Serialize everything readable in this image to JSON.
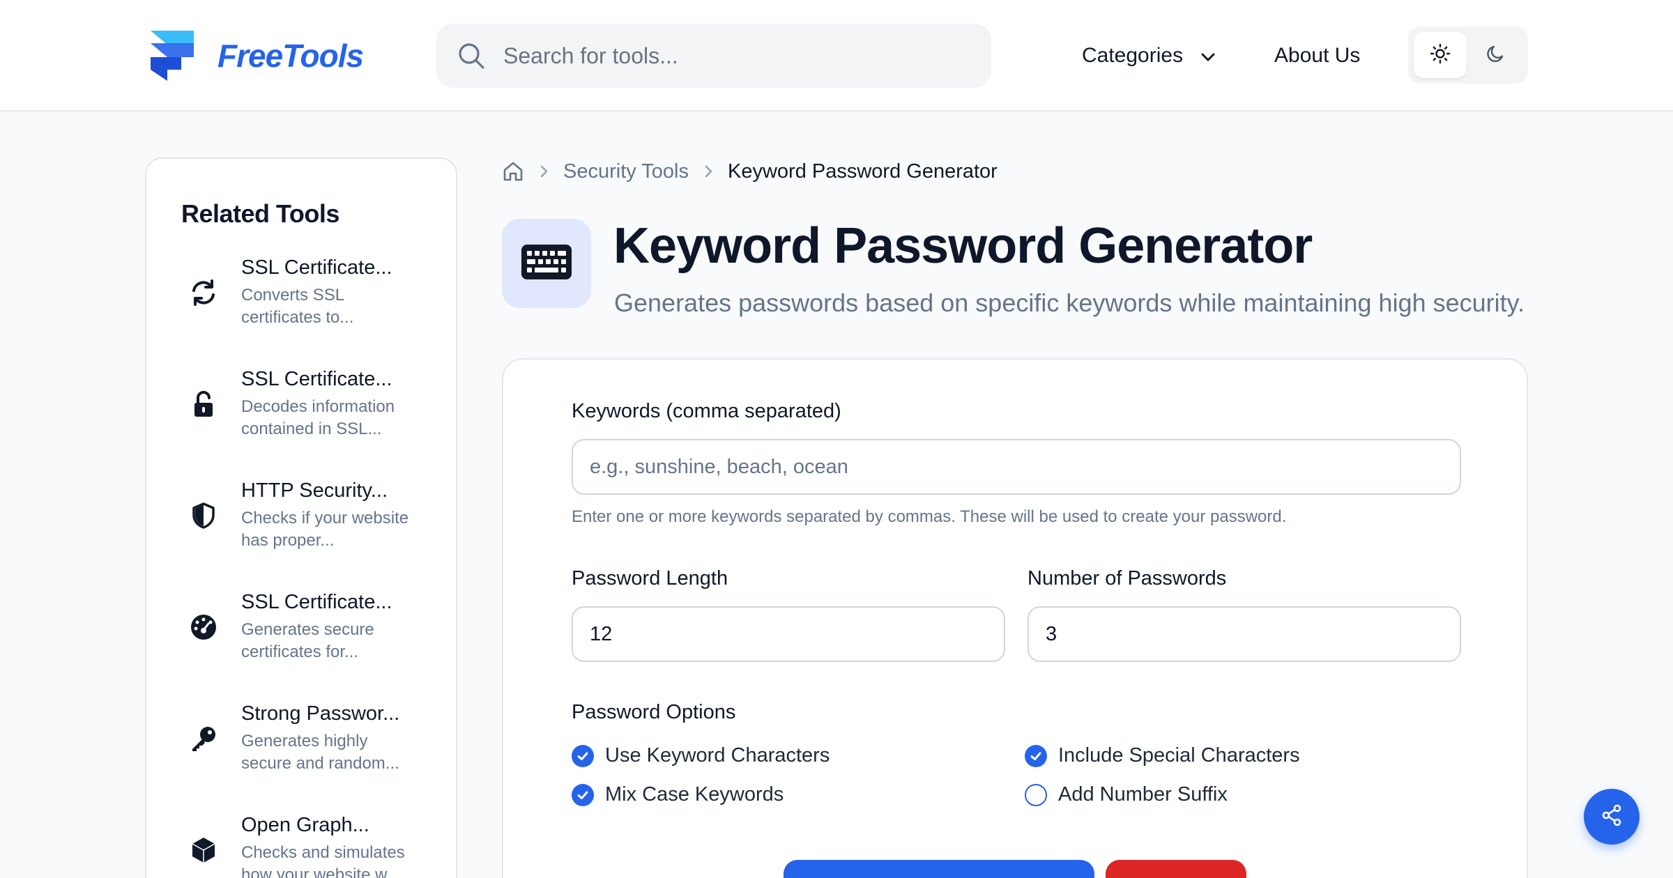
{
  "header": {
    "brand": "FreeTools",
    "search_placeholder": "Search for tools...",
    "nav": {
      "categories": "Categories",
      "about": "About Us"
    },
    "theme": {
      "selected": "light"
    }
  },
  "sidebar": {
    "title": "Related Tools",
    "items": [
      {
        "name": "SSL Certificate...",
        "desc": "Converts SSL certificates to...",
        "icon": "refresh-icon"
      },
      {
        "name": "SSL Certificate...",
        "desc": "Decodes information contained in SSL...",
        "icon": "unlock-icon"
      },
      {
        "name": "HTTP Security...",
        "desc": "Checks if your website has proper...",
        "icon": "shield-icon"
      },
      {
        "name": "SSL Certificate...",
        "desc": "Generates secure certificates for...",
        "icon": "gauge-icon"
      },
      {
        "name": "Strong Passwor...",
        "desc": "Generates highly secure and random...",
        "icon": "key-icon"
      },
      {
        "name": "Open Graph...",
        "desc": "Checks and simulates how your website w...",
        "icon": "cube-icon"
      }
    ]
  },
  "breadcrumb": {
    "section": "Security Tools",
    "current": "Keyword Password Generator"
  },
  "page": {
    "title": "Keyword Password Generator",
    "subtitle": "Generates passwords based on specific keywords while maintaining high security.",
    "icon": "keyboard-icon"
  },
  "form": {
    "keywords_label": "Keywords (comma separated)",
    "keywords_placeholder": "e.g., sunshine, beach, ocean",
    "keywords_value": "",
    "keywords_help": "Enter one or more keywords separated by commas. These will be used to create your password.",
    "length_label": "Password Length",
    "length_value": "12",
    "count_label": "Number of Passwords",
    "count_value": "3",
    "options_label": "Password Options",
    "options": [
      {
        "label": "Use Keyword Characters",
        "checked": true
      },
      {
        "label": "Include Special Characters",
        "checked": true
      },
      {
        "label": "Mix Case Keywords",
        "checked": true
      },
      {
        "label": "Add Number Suffix",
        "checked": false
      }
    ]
  },
  "colors": {
    "accent": "#2563eb",
    "danger": "#dc2626",
    "muted_text": "#64748b",
    "icon_bg": "#e0e7ff"
  }
}
